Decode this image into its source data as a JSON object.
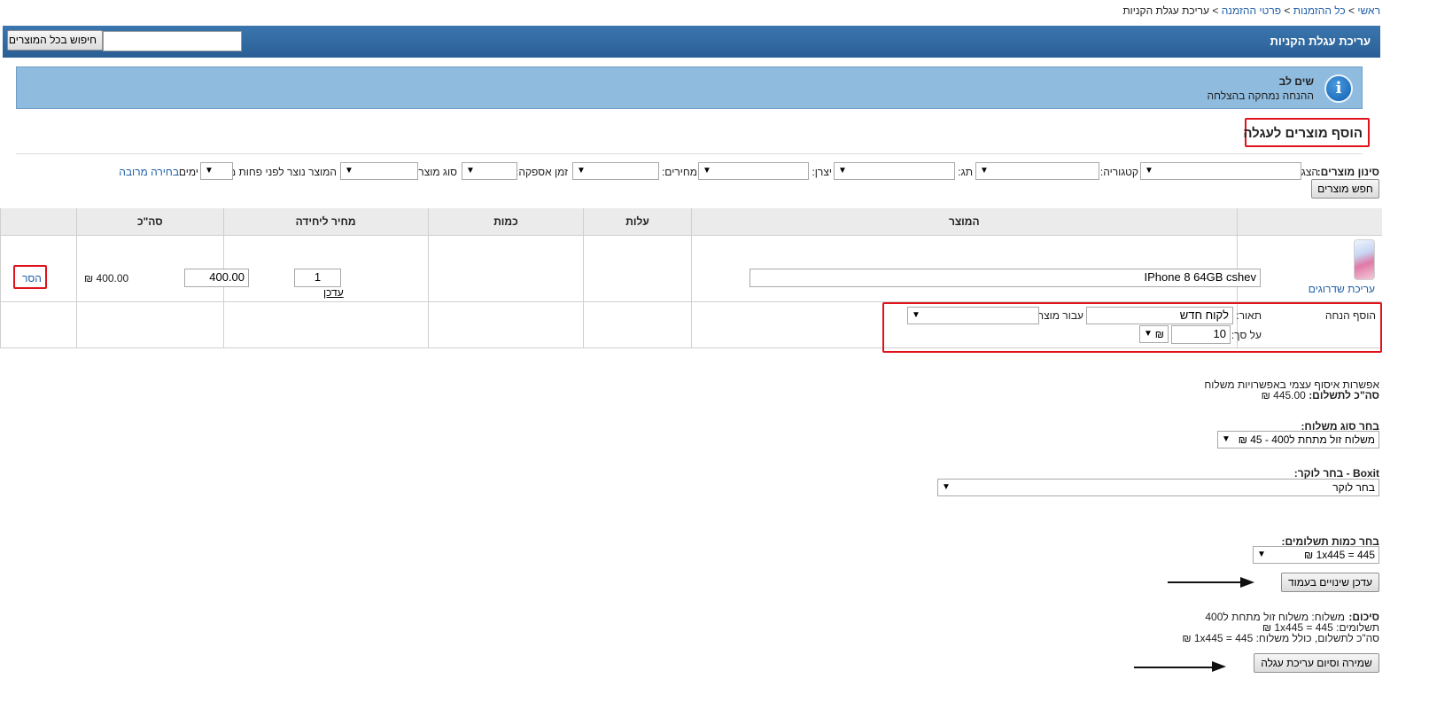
{
  "breadcrumb": {
    "home": "ראשי",
    "orders": "כל ההזמנות",
    "order_details": "פרטי ההזמנה",
    "current": "עריכת עגלת הקניות",
    "separator": ">"
  },
  "header": {
    "title": "עריכת עגלת הקניות",
    "search_value": "",
    "search_button": "חיפוש בכל המוצרים",
    "bg_color": "#2f6aa3"
  },
  "notice": {
    "title": "שים לב",
    "message": "ההנחה נמחקה בהצלחה",
    "icon": "info-icon",
    "bg_color": "#8fbbde"
  },
  "add_products": {
    "title": "הוסף מוצרים לעגלה"
  },
  "filters": {
    "label": "סינון מוצרים:",
    "display_label": "הצג:",
    "category_label": "קטגוריה:",
    "tag_label": "תג:",
    "manufacturer_label": "יצרן:",
    "prices_label": "מחירים:",
    "supply_time_label": "זמן אספקה:",
    "product_type_label": "סוג מוצר:",
    "created_label": "המוצר נוצר לפני פחות מ:",
    "days_label": "ימים",
    "multi_select_link": "בחירה מרובה",
    "search_button": "חפש מוצרים"
  },
  "table": {
    "headers": [
      "המוצר",
      "עלות",
      "כמות",
      "מחיר ליחידה",
      "סה\"כ"
    ],
    "row": {
      "product_name": "IPhone 8 64GB cshev",
      "upgrade_link": "עריכת שדרוגים",
      "quantity": "1",
      "update_link": "עדכן",
      "unit_price": "400.00",
      "total": "400.00 ₪",
      "remove_link": "הסר"
    },
    "discount": {
      "label": "הוסף הנחה",
      "description_label": "תאור:",
      "description_value": "לקוח חדש",
      "for_product_label": "עבור מוצר:",
      "amount_label": "על סך:",
      "amount_value": "10",
      "currency": "₪"
    }
  },
  "shipping": {
    "self_pickup_note": "אפשרות איסוף עצמי באפשרויות משלוח",
    "total_label": "סה\"כ לתשלום:",
    "total_value": "445.00 ₪",
    "type_label": "בחר סוג משלוח:",
    "type_value": "משלוח זול מתחת ל400 - 45 ₪",
    "locker_label": "Boxit - בחר לוקר:",
    "locker_value": "בחר לוקר",
    "payments_label": "בחר כמות תשלומים:",
    "payments_value": "445 = 1x445 ₪",
    "update_button": "עדכן שינויים בעמוד"
  },
  "summary": {
    "label": "סיכום:",
    "shipping_line": "משלוח: משלוח זול מתחת ל400",
    "payments_line": "תשלומים: 445 = 1x445 ₪",
    "total_line": "סה\"כ לתשלום, כולל משלוח: 445 = 1x445 ₪",
    "save_button": "שמירה וסיום עריכת עגלה"
  }
}
